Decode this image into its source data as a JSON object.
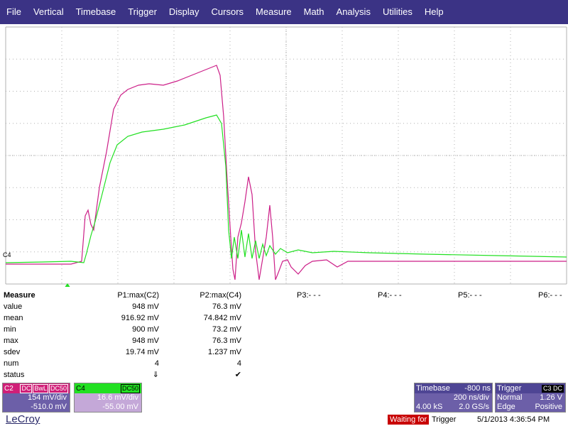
{
  "menu": [
    "File",
    "Vertical",
    "Timebase",
    "Trigger",
    "Display",
    "Cursors",
    "Measure",
    "Math",
    "Analysis",
    "Utilities",
    "Help"
  ],
  "colors": {
    "menubar": "#3b3385",
    "trace_c2": "#cc1f88",
    "trace_c4": "#22e022",
    "grid": "#b0b0b0"
  },
  "channel_marker": "C4",
  "measure": {
    "title": "Measure",
    "headers": {
      "p1": "P1:max(C2)",
      "p2": "P2:max(C4)",
      "p3": "P3:- - -",
      "p4": "P4:- - -",
      "p5": "P5:- - -",
      "p6": "P6:- - -"
    },
    "rows": [
      {
        "label": "value",
        "p1": "948 mV",
        "p2": "76.3 mV"
      },
      {
        "label": "mean",
        "p1": "916.92 mV",
        "p2": "74.842 mV"
      },
      {
        "label": "min",
        "p1": "900 mV",
        "p2": "73.2 mV"
      },
      {
        "label": "max",
        "p1": "948 mV",
        "p2": "76.3 mV"
      },
      {
        "label": "sdev",
        "p1": "19.74 mV",
        "p2": "1.237 mV"
      },
      {
        "label": "num",
        "p1": "4",
        "p2": "4"
      },
      {
        "label": "status",
        "p1": "⇓",
        "p2": "✔"
      }
    ]
  },
  "channels": {
    "c2": {
      "name": "C2",
      "tags": [
        "DC",
        "BwL",
        "DC50"
      ],
      "scale": "154 mV/div",
      "offset": "-510.0 mV"
    },
    "c4": {
      "name": "C4",
      "tags": [
        "DC50"
      ],
      "scale": "16.6 mV/div",
      "offset": "-55.00 mV"
    }
  },
  "timebase": {
    "title": "Timebase",
    "delay": "-800 ns",
    "scale": "200 ns/div",
    "samples": "4.00 kS",
    "rate": "2.0 GS/s"
  },
  "trigger": {
    "title": "Trigger",
    "tag": "C3 DC",
    "mode": "Normal",
    "level": "1.26 V",
    "type": "Edge",
    "slope": "Positive"
  },
  "footer": {
    "logo": "LeCroy",
    "status_highlight": "Waiting for",
    "status_rest": "Trigger",
    "datetime": "5/1/2013 4:36:54 PM"
  }
}
